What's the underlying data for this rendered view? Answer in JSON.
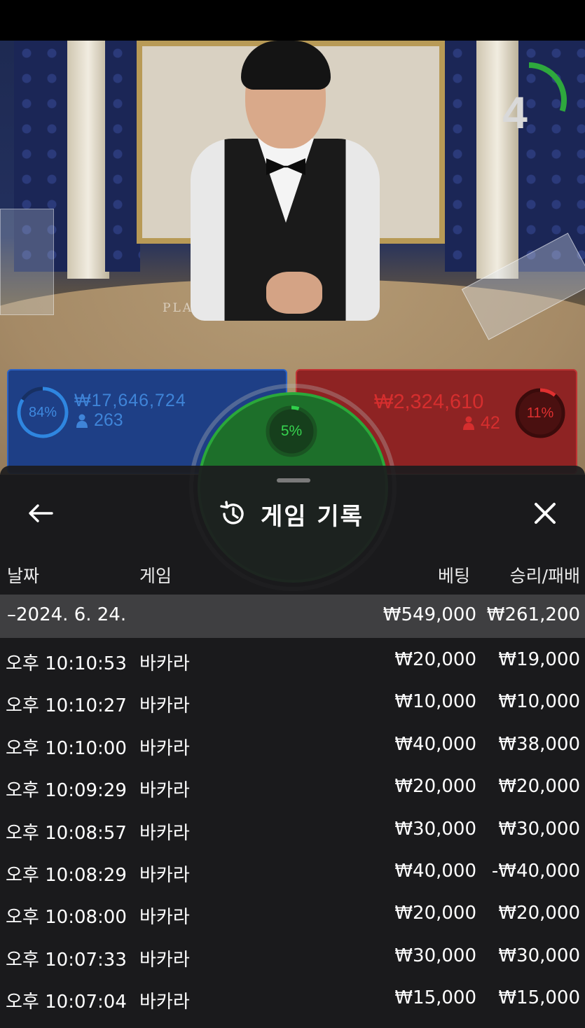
{
  "timer": {
    "value": "4",
    "fraction_remaining": 0.3
  },
  "table_text": "PLAY        ANKER",
  "player": {
    "percent": "84%",
    "amount": "₩17,646,724",
    "count": "263",
    "color": "#2c63c4",
    "fraction": 0.84
  },
  "tie": {
    "percent": "5%",
    "color": "#2aa83a",
    "fraction": 0.05
  },
  "banker": {
    "percent": "11%",
    "amount": "₩2,324,610",
    "count": "42",
    "color": "#d62e2e",
    "fraction": 0.11
  },
  "history": {
    "title": "게임 기록",
    "columns": {
      "date": "날짜",
      "game": "게임",
      "bet": "베팅",
      "result": "승리/패배"
    },
    "day": {
      "date": "–2024. 6. 24.",
      "bet": "₩549,000",
      "result": "₩261,200"
    },
    "rows": [
      {
        "time": "오후 10:10:53",
        "game": "바카라",
        "bet": "₩20,000",
        "result": "₩19,000"
      },
      {
        "time": "오후 10:10:27",
        "game": "바카라",
        "bet": "₩10,000",
        "result": "₩10,000"
      },
      {
        "time": "오후 10:10:00",
        "game": "바카라",
        "bet": "₩40,000",
        "result": "₩38,000"
      },
      {
        "time": "오후 10:09:29",
        "game": "바카라",
        "bet": "₩20,000",
        "result": "₩20,000"
      },
      {
        "time": "오후 10:08:57",
        "game": "바카라",
        "bet": "₩30,000",
        "result": "₩30,000"
      },
      {
        "time": "오후 10:08:29",
        "game": "바카라",
        "bet": "₩40,000",
        "result": "-₩40,000"
      },
      {
        "time": "오후 10:08:00",
        "game": "바카라",
        "bet": "₩20,000",
        "result": "₩20,000"
      },
      {
        "time": "오후 10:07:33",
        "game": "바카라",
        "bet": "₩30,000",
        "result": "₩30,000"
      },
      {
        "time": "오후 10:07:04",
        "game": "바카라",
        "bet": "₩15,000",
        "result": "₩15,000"
      }
    ]
  }
}
